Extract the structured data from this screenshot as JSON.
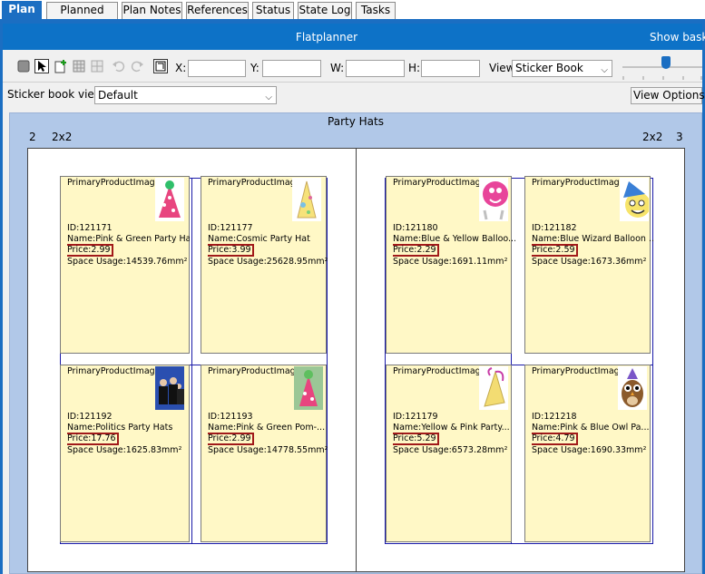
{
  "tabs": [
    {
      "label": "Plan",
      "active": true
    },
    {
      "label": "Planned Page"
    },
    {
      "label": "Plan Notes"
    },
    {
      "label": "References"
    },
    {
      "label": "Status"
    },
    {
      "label": "State Log"
    },
    {
      "label": "Tasks"
    }
  ],
  "titlebar": {
    "title": "Flatplanner",
    "right": "Show baske"
  },
  "toolbar": {
    "x_label": "X:",
    "y_label": "Y:",
    "w_label": "W:",
    "h_label": "H:",
    "view_label": "View",
    "view_value": "Sticker Book",
    "icons": [
      "stop-icon",
      "pointer-icon",
      "add-page-icon",
      "grid-icon",
      "undo-icon",
      "redo-icon",
      "fit-icon"
    ]
  },
  "sticker_book": {
    "label": "Sticker book view:",
    "value": "Default",
    "view_options": "View Options"
  },
  "spread": {
    "title": "Party Hats",
    "left_page_num": "2",
    "left_size": "2x2",
    "right_size": "2x2",
    "right_page_num": "3"
  },
  "cards": [
    {
      "label": "PrimaryProductImage:",
      "id": "ID:121171",
      "name": "Name:Pink & Green Party Hat",
      "price": "Price:2.99",
      "space": "Space Usage:14539.76mm²",
      "thumb": "pink-cone-hat"
    },
    {
      "label": "PrimaryProductImage:",
      "id": "ID:121177",
      "name": "Name:Cosmic Party Hat",
      "price": "Price:3.99",
      "space": "Space Usage:25628.95mm²",
      "thumb": "cosmic-cone-hat"
    },
    {
      "label": "PrimaryProductImage:",
      "id": "ID:121192",
      "name": "Name:Politics Party Hats",
      "price": "Price:17.76",
      "space": "Space Usage:1625.83mm²",
      "thumb": "politics-photo"
    },
    {
      "label": "PrimaryProductImage:",
      "id": "ID:121193",
      "name": "Name:Pink & Green Pom-...",
      "price": "Price:2.99",
      "space": "Space Usage:14778.55mm²",
      "thumb": "pink-pom-hat"
    },
    {
      "label": "PrimaryProductImage:",
      "id": "ID:121180",
      "name": "Name:Blue & Yellow Balloo...",
      "price": "Price:2.29",
      "space": "Space Usage:1691.11mm²",
      "thumb": "balloon-character"
    },
    {
      "label": "PrimaryProductImage:",
      "id": "ID:121182",
      "name": "Name:Blue Wizard Balloon ...",
      "price": "Price:2.59",
      "space": "Space Usage:1673.36mm²",
      "thumb": "wizard-balloon"
    },
    {
      "label": "PrimaryProductImage:",
      "id": "ID:121179",
      "name": "Name:Yellow & Pink Party...",
      "price": "Price:5.29",
      "space": "Space Usage:6573.28mm²",
      "thumb": "yellow-pink-hat"
    },
    {
      "label": "PrimaryProductImage:",
      "id": "ID:121218",
      "name": "Name:Pink & Blue Owl Pa...",
      "price": "Price:4.79",
      "space": "Space Usage:1690.33mm²",
      "thumb": "owl-hat"
    }
  ],
  "colors": {
    "accent": "#1b6ec2",
    "card": "#fff8c6",
    "price_border": "#a11a1a",
    "workarea": "#b1c8e8"
  }
}
